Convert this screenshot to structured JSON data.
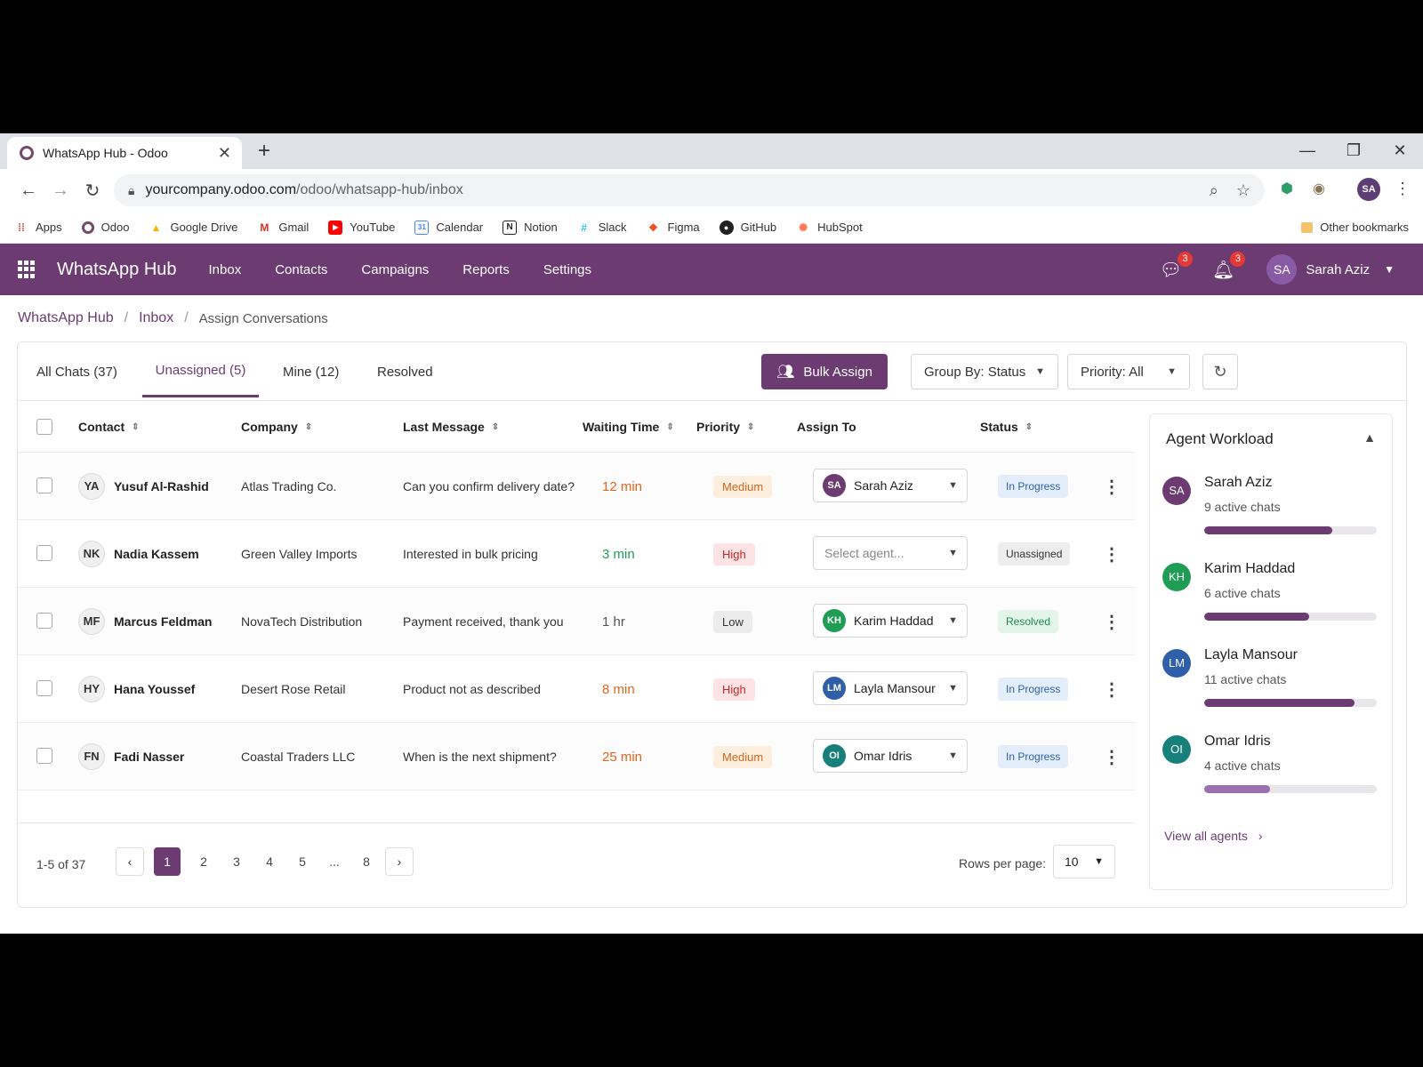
{
  "browser": {
    "tab_title": "WhatsApp Hub - Odoo",
    "url_host": "yourcompany.odoo.com",
    "url_path": "/odoo/whatsapp-hub/inbox",
    "profile_initials": "SA",
    "bookmarks": [
      "Apps",
      "Odoo",
      "Google Drive",
      "Gmail",
      "YouTube",
      "Calendar",
      "Notion",
      "Slack",
      "Figma",
      "GitHub",
      "HubSpot"
    ],
    "other_bookmarks": "Other bookmarks"
  },
  "app": {
    "name": "WhatsApp Hub",
    "nav": [
      "Inbox",
      "Contacts",
      "Campaigns",
      "Reports",
      "Settings"
    ],
    "messages_badge": "3",
    "notifications_badge": "3",
    "user_initials": "SA",
    "user_name": "Sarah Aziz",
    "accent_color": "#6b3b72"
  },
  "breadcrumb": {
    "root": "WhatsApp Hub",
    "section": "Inbox",
    "current": "Assign Conversations"
  },
  "filters": {
    "tabs": [
      "All Chats (37)",
      "Unassigned (5)",
      "Mine (12)",
      "Resolved"
    ],
    "active_tab": "Unassigned (5)",
    "bulk_assign": "Bulk Assign",
    "group_by": "Group By: Status",
    "priority": "Priority: All"
  },
  "table": {
    "headers": {
      "contact": "Contact",
      "company": "Company",
      "last_message": "Last Message",
      "waiting": "Waiting Time",
      "priority": "Priority",
      "assign": "Assign To",
      "status": "Status"
    },
    "rows": [
      {
        "initials": "YA",
        "name": "Yusuf Al-Rashid",
        "company": "Atlas Trading Co.",
        "message": "Can you confirm delivery date?",
        "waiting": "12 min",
        "priority": "Medium",
        "agent_initials": "SA",
        "agent": "Sarah Aziz",
        "status": "In Progress"
      },
      {
        "initials": "NK",
        "name": "Nadia Kassem",
        "company": "Green Valley Imports",
        "message": "Interested in bulk pricing",
        "waiting": "3 min",
        "priority": "High",
        "agent_placeholder": "Select agent...",
        "status": "Unassigned"
      },
      {
        "initials": "MF",
        "name": "Marcus Feldman",
        "company": "NovaTech Distribution",
        "message": "Payment received, thank you",
        "waiting": "1 hr",
        "priority": "Low",
        "agent_initials": "KH",
        "agent": "Karim Haddad",
        "status": "Resolved"
      },
      {
        "initials": "HY",
        "name": "Hana Youssef",
        "company": "Desert Rose Retail",
        "message": "Product not as described",
        "waiting": "8 min",
        "priority": "High",
        "agent_initials": "LM",
        "agent": "Layla Mansour",
        "status": "In Progress"
      },
      {
        "initials": "FN",
        "name": "Fadi Nasser",
        "company": "Coastal Traders LLC",
        "message": "When is the next shipment?",
        "waiting": "25 min",
        "priority": "Medium",
        "agent_initials": "OI",
        "agent": "Omar Idris",
        "status": "In Progress"
      }
    ]
  },
  "pagination": {
    "info": "1-5 of 37",
    "pages": [
      "1",
      "2",
      "3",
      "4",
      "5",
      "...",
      "8"
    ],
    "active_page": "1",
    "rows_label": "Rows per page:",
    "rows_value": "10"
  },
  "workload": {
    "title": "Agent Workload",
    "agents": [
      {
        "initials": "SA",
        "name": "Sarah Aziz",
        "chats": "9 active chats",
        "load": 0.74,
        "color": "#6b3b72"
      },
      {
        "initials": "KH",
        "name": "Karim Haddad",
        "chats": "6 active chats",
        "load": 0.61,
        "color": "#1f9d55"
      },
      {
        "initials": "LM",
        "name": "Layla Mansour",
        "chats": "11 active chats",
        "load": 0.87,
        "color": "#2f5fa8"
      },
      {
        "initials": "OI",
        "name": "Omar Idris",
        "chats": "4 active chats",
        "load": 0.38,
        "color": "#17807a"
      }
    ],
    "view_all": "View all agents"
  }
}
